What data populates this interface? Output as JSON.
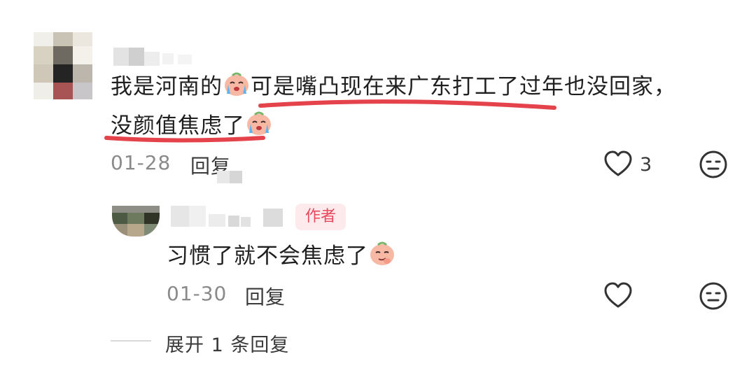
{
  "comment": {
    "text_line1": "我是河南的",
    "text_line1b": "可是嘴凸现在来广东打工了过年也没回家，",
    "text_line2": "没颜值焦虑了",
    "date": "01-28",
    "reply_label": "回复",
    "like_count": "3"
  },
  "reply": {
    "author_badge": "作者",
    "text": "习惯了就不会焦虑了",
    "date": "01-30",
    "reply_label": "回复"
  },
  "expand": {
    "label": "展开 1 条回复"
  },
  "colors": {
    "underline": "#e5434b",
    "badge_bg": "#fdeaec",
    "badge_text": "#e8485c"
  },
  "icons": [
    "heart-icon",
    "dislike-face-icon",
    "crying-emoji-icon",
    "smirk-emoji-icon"
  ]
}
